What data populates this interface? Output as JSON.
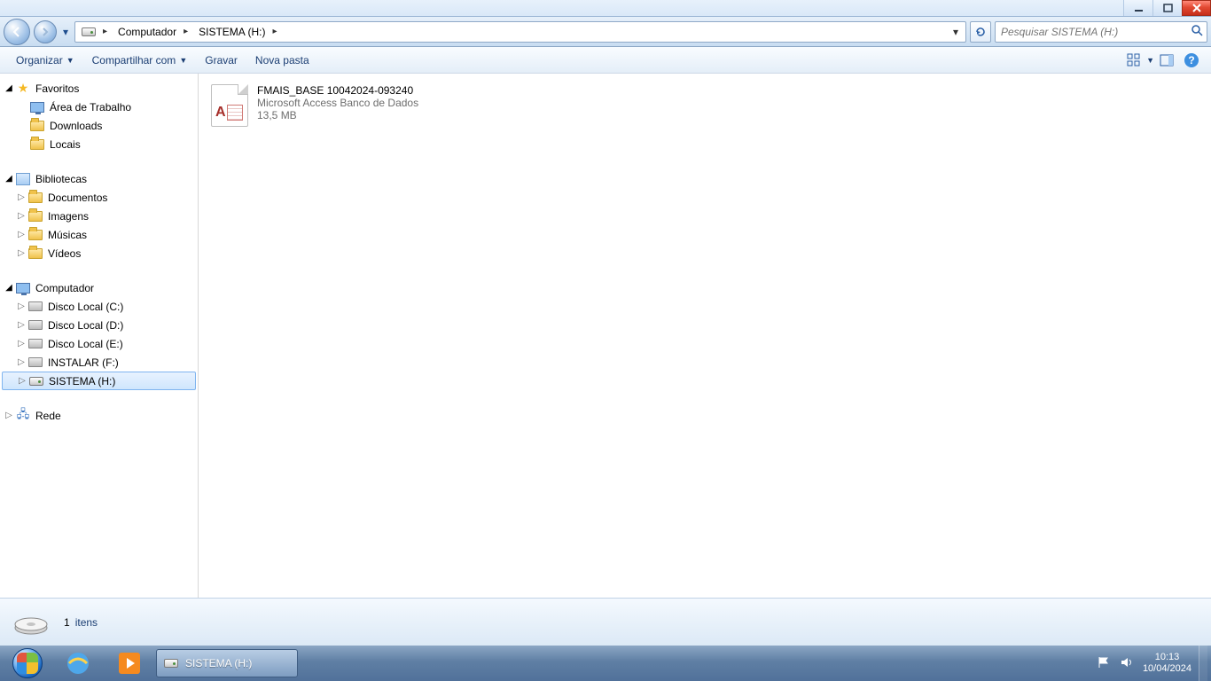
{
  "window_controls": {
    "minimize": "min",
    "maximize": "max",
    "close": "close"
  },
  "breadcrumb": {
    "root_icon": "drive",
    "segments": [
      "Computador",
      "SISTEMA (H:)"
    ]
  },
  "address_actions": {
    "dropdown": "▾",
    "refresh": "↻"
  },
  "search": {
    "placeholder": "Pesquisar SISTEMA (H:)"
  },
  "toolbar": {
    "organize": "Organizar",
    "share": "Compartilhar com",
    "burn": "Gravar",
    "new_folder": "Nova pasta"
  },
  "sidebar": {
    "favorites": {
      "label": "Favoritos",
      "items": [
        "Área de Trabalho",
        "Downloads",
        "Locais"
      ]
    },
    "libraries": {
      "label": "Bibliotecas",
      "items": [
        "Documentos",
        "Imagens",
        "Músicas",
        "Vídeos"
      ]
    },
    "computer": {
      "label": "Computador",
      "items": [
        "Disco Local (C:)",
        "Disco Local (D:)",
        "Disco Local (E:)",
        "INSTALAR (F:)",
        "SISTEMA (H:)"
      ],
      "selected_index": 4
    },
    "network": {
      "label": "Rede"
    }
  },
  "files": [
    {
      "name": "FMAIS_BASE 10042024-093240",
      "type": "Microsoft Access Banco de Dados",
      "size": "13,5 MB"
    }
  ],
  "status": {
    "count": "1",
    "label": "itens"
  },
  "taskbar": {
    "active_window": "SISTEMA (H:)",
    "clock_time": "10:13",
    "clock_date": "10/04/2024"
  }
}
